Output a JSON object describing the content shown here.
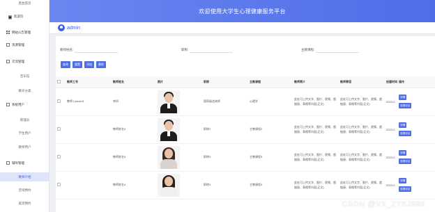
{
  "sidebar": {
    "top_label": "后台首页",
    "home_label": "欢迎页",
    "items": [
      {
        "label": "网站公告管理",
        "type": "group",
        "icon": "grid-icon"
      },
      {
        "label": "资源管理",
        "type": "group",
        "icon": "box-icon"
      },
      {
        "label": "交流管理",
        "type": "group",
        "icon": "box-icon"
      },
      {
        "label": "音乐馆",
        "type": "sub"
      },
      {
        "label": "聊天分类",
        "type": "sub"
      },
      {
        "label": "系统用户",
        "type": "group",
        "icon": "box-icon"
      },
      {
        "label": "管理员",
        "type": "sub"
      },
      {
        "label": "学生用户",
        "type": "sub"
      },
      {
        "label": "教师用户",
        "type": "sub"
      },
      {
        "label": "辅导管理",
        "type": "group",
        "icon": "box-icon"
      },
      {
        "label": "教师介绍",
        "type": "sub",
        "active": true
      },
      {
        "label": "咨询预约",
        "type": "sub"
      },
      {
        "label": "取消预约",
        "type": "sub"
      }
    ]
  },
  "header": {
    "title": "欢迎使用大学生心理健康服务平台"
  },
  "user": {
    "name": "admin"
  },
  "search": {
    "fields": [
      {
        "label": "教师姓名:",
        "value": ""
      },
      {
        "label": "职称:",
        "value": ""
      },
      {
        "label": "主教课程:",
        "value": ""
      }
    ]
  },
  "actions": [
    "查询",
    "重置",
    "添加",
    "删除"
  ],
  "table": {
    "headers": [
      "",
      "教师工号",
      "教师姓名",
      "照片",
      "职称",
      "主教课程",
      "教师简介",
      "教师寄语",
      "创建时间",
      "操作"
    ],
    "rows": [
      {
        "id": "教师1 jiaoshi1",
        "name": "李四",
        "title": "国家级咨询师",
        "course": "心理学",
        "intro": "此处可上传文字、图片、视频、超链接、表格等内容(正文)",
        "motto": "此处可上传文字、图片、视频、超链接、表格等内容(正文)",
        "created": "2023-0",
        "photo": "m"
      },
      {
        "id": "",
        "name": "教师姓名2",
        "title": "职称2",
        "course": "主教课程2",
        "intro": "此处可上传文字、图片、视频、超链接、表格等内容(正文)",
        "motto": "此处可上传文字、图片、视频、超链接、表格等内容(正文)",
        "created": "2023-0",
        "photo": "m"
      },
      {
        "id": "",
        "name": "教师姓名3",
        "title": "职称3",
        "course": "主教课程3",
        "intro": "此处可上传文字、图片、视频、超链接、表格等内容(正文)",
        "motto": "此处可上传文字、图片、视频、超链接、表格等内容(正文)",
        "created": "2023-0",
        "photo": "f"
      },
      {
        "id": "",
        "name": "教师姓名4",
        "title": "职称4",
        "course": "主教课程4",
        "intro": "此处可上传文字、图片、视频、超链接、表格等内容(正文)",
        "motto": "此处可上传文字、图片、视频、超链接、表格等内容(正文)",
        "created": "2023-0",
        "photo": "f2"
      }
    ],
    "op_labels": [
      "详情",
      "查看评论"
    ]
  },
  "watermark": "CSDN @VX_ZYKJ986",
  "colors": {
    "accent": "#4f6ee8",
    "header_start": "#6a86f0",
    "active_bg": "#dfe4fa"
  }
}
